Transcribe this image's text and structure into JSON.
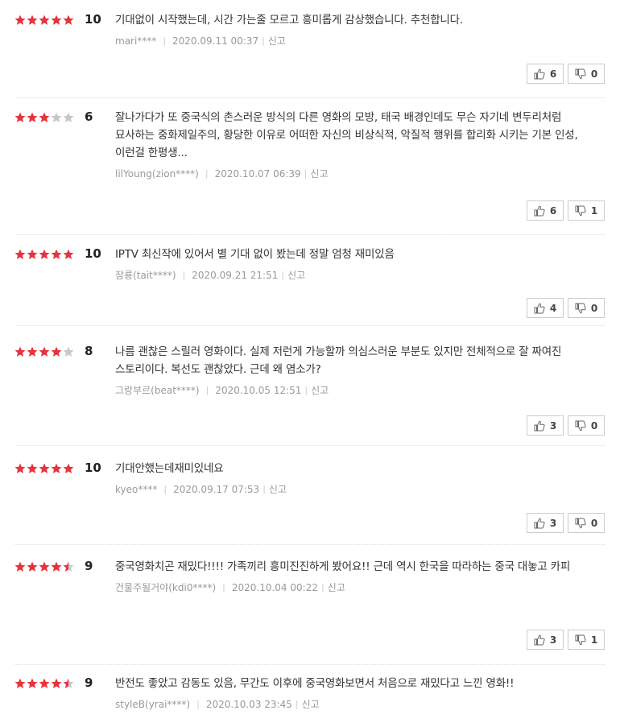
{
  "colors": {
    "star_on": "#e8333e",
    "star_off": "#c8c8c8"
  },
  "reviews": [
    {
      "stars": [
        1,
        1,
        1,
        1,
        1
      ],
      "score": "10",
      "text": "기대없이 시작했는데, 시간 가는줄 모르고 흥미롭게 감상했습니다. 추천합니다.",
      "user": "mari****",
      "date": "2020.09.11 00:37",
      "report": "신고",
      "likes": "6",
      "dislikes": "0"
    },
    {
      "stars": [
        1,
        1,
        1,
        0,
        0
      ],
      "score": "6",
      "text": "잘나가다가 또 중국식의 촌스러운 방식의 다른 영화의 모방, 태국 배경인데도 무슨 자기네 변두리처럼 묘사하는 중화제일주의, 황당한 이유로 어떠한 자신의 비상식적, 악질적 행위를 합리화 시키는 기본 인성, 이런걸 한평생...",
      "user": "lilYoung(zion****)",
      "date": "2020.10.07 06:39",
      "report": "신고",
      "likes": "6",
      "dislikes": "1"
    },
    {
      "stars": [
        1,
        1,
        1,
        1,
        1
      ],
      "score": "10",
      "text": "IPTV 최신작에 있어서 별 기대 없이 봤는데 정말 엄청 재미있음",
      "user": "잠룡(tait****)",
      "date": "2020.09.21 21:51",
      "report": "신고",
      "likes": "4",
      "dislikes": "0"
    },
    {
      "stars": [
        1,
        1,
        1,
        1,
        0
      ],
      "score": "8",
      "text": "나름 괜찮은 스릴러 영화이다. 실제 저런게 가능할까 의심스러운 부분도 있지만 전체적으로 잘 짜여진 스토리이다. 복선도 괜찮았다. 근데 왜 염소가?",
      "user": "그랑부르(beat****)",
      "date": "2020.10.05 12:51",
      "report": "신고",
      "likes": "3",
      "dislikes": "0"
    },
    {
      "stars": [
        1,
        1,
        1,
        1,
        1
      ],
      "score": "10",
      "text": "기대안했는데재미있네요",
      "user": "kyeo****",
      "date": "2020.09.17 07:53",
      "report": "신고",
      "likes": "3",
      "dislikes": "0"
    },
    {
      "stars": [
        1,
        1,
        1,
        1,
        0.5
      ],
      "score": "9",
      "text": "중국영화치곤 재밌다!!!! 가족끼리 흥미진진하게 봤어요!! 근데 역시 한국을 따라하는 중국 대놓고 카피",
      "user": "건물주될거야(kdi0****)",
      "date": "2020.10.04 00:22",
      "report": "신고",
      "likes": "3",
      "dislikes": "1"
    },
    {
      "stars": [
        1,
        1,
        1,
        1,
        0.5
      ],
      "score": "9",
      "text": "반전도 좋았고 감동도 있음, 무간도 이후에 중국영화보면서 처음으로 재밌다고 느낀 영화!!",
      "user": "styleB(yrai****)",
      "date": "2020.10.03 23:45",
      "report": "신고",
      "likes": "",
      "dislikes": ""
    }
  ]
}
